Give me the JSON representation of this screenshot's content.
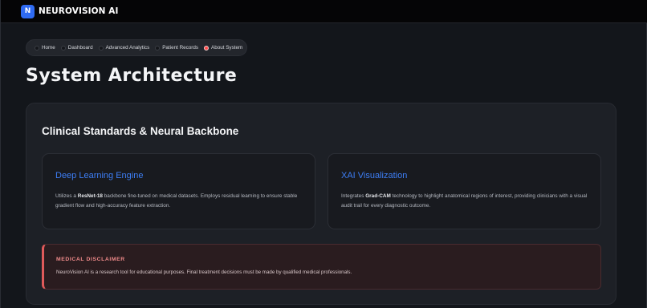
{
  "header": {
    "logo_letter": "N",
    "app_name": "NEUROVISION AI",
    "brand_color": "#2f6bf2"
  },
  "nav": {
    "items": [
      {
        "label": "Home",
        "active": false
      },
      {
        "label": "Dashboard",
        "active": false
      },
      {
        "label": "Advanced Analytics",
        "active": false
      },
      {
        "label": "Patient Records",
        "active": false
      },
      {
        "label": "About System",
        "active": true
      }
    ],
    "active_color": "#ff4b4b"
  },
  "page": {
    "title": "System Architecture"
  },
  "section": {
    "title": "Clinical Standards & Neural Backbone",
    "cards": [
      {
        "title": "Deep Learning Engine",
        "text_before": "Utilizes a ",
        "text_bold": "ResNet-18",
        "text_after": " backbone fine-tuned on medical datasets. Employs residual learning to ensure stable gradient flow and high-accuracy feature extraction."
      },
      {
        "title": "XAI Visualization",
        "text_before": "Integrates ",
        "text_bold": "Grad-CAM",
        "text_after": " technology to highlight anatomical regions of interest, providing clinicians with a visual audit trail for every diagnostic outcome."
      }
    ],
    "accent_color": "#3d7ef5"
  },
  "disclaimer": {
    "title": "MEDICAL DISCLAIMER",
    "text": "NeuroVision AI is a research tool for educational purposes. Final treatment decisions must be made by qualified medical professionals.",
    "accent_color": "#e05a5a"
  }
}
